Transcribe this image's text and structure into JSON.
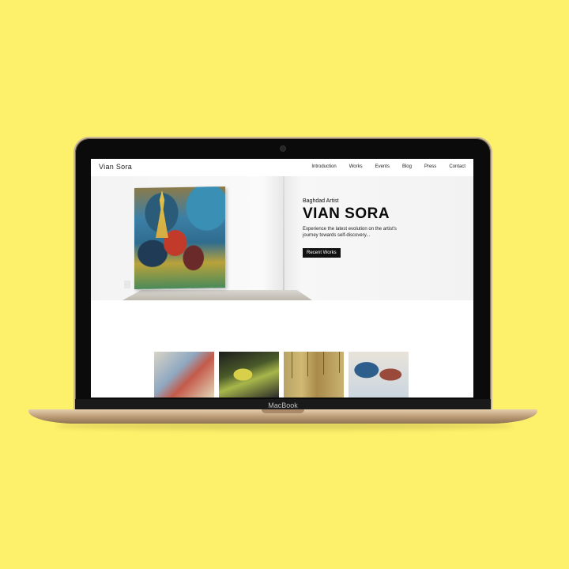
{
  "device": {
    "brand_label": "MacBook"
  },
  "site": {
    "logo": "Vian Sora",
    "nav": [
      "Introduction",
      "Works",
      "Events",
      "Blog",
      "Press",
      "Contact"
    ],
    "hero": {
      "subtitle": "Baghdad Artist",
      "title": "VIAN SORA",
      "description": "Experience the latest evolution on the artist's journey towards self-discovery...",
      "cta_label": "Recent Works"
    }
  },
  "colors": {
    "background": "#fdf06a",
    "cta": "#111111"
  }
}
